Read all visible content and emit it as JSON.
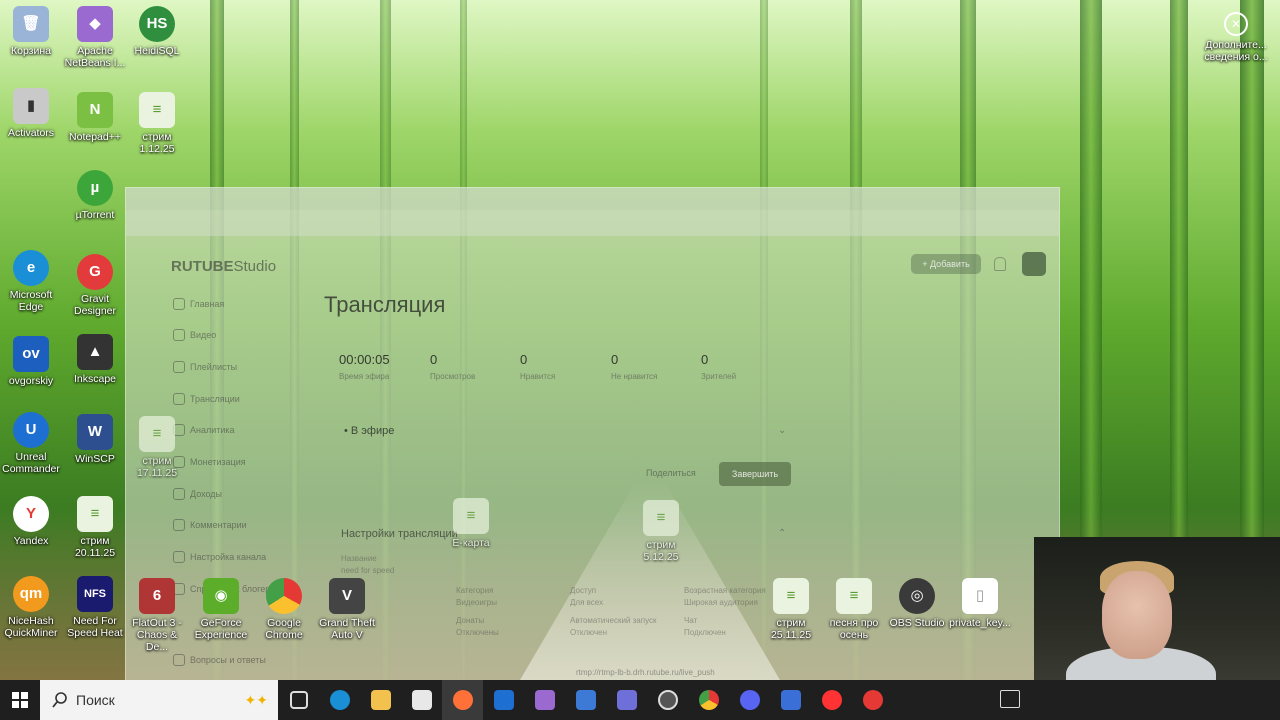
{
  "desktop": {
    "icons_left": [
      {
        "label": "Корзина",
        "color": "#9ab4d8",
        "glyph": "🗑"
      },
      {
        "label": "Activators",
        "color": "#c9c9c9",
        "glyph": "▮"
      },
      {
        "label": "µTorrent",
        "color": "#3da63a",
        "glyph": "µ"
      },
      {
        "label": "Microsoft Edge",
        "color": "#1a8fd6",
        "glyph": "e"
      },
      {
        "label": "ovgorskiy",
        "color": "#1d5fbf",
        "glyph": "ov"
      },
      {
        "label": "Unreal Commander",
        "color": "#1d6fd1",
        "glyph": "U"
      },
      {
        "label": "Yandex",
        "color": "#ffffff",
        "glyph": "Y"
      },
      {
        "label": "NiceHash QuickMiner",
        "color": "#f29a1d",
        "glyph": "qm"
      }
    ],
    "icons_col2": [
      {
        "label": "Apache NetBeans I...",
        "color": "#9b6ad1",
        "glyph": "◆"
      },
      {
        "label": "Notepad++",
        "color": "#7bc043",
        "glyph": "N"
      },
      {
        "label": "Gravit Designer",
        "color": "#e33b3b",
        "glyph": "G"
      },
      {
        "label": "Inkscape",
        "color": "#333333",
        "glyph": "▲"
      },
      {
        "label": "WinSCP",
        "color": "#2d4f8f",
        "glyph": "W"
      },
      {
        "label": "стрим 20.11.25",
        "color": "#eaf3df",
        "glyph": "≡"
      },
      {
        "label": "Need For Speed Heat",
        "color": "#1a1a6e",
        "glyph": "NFS"
      }
    ],
    "icons_col3": [
      {
        "label": "HeidiSQL",
        "color": "#2f8f3f",
        "glyph": "HS"
      },
      {
        "label": "стрим 1.12.25",
        "color": "#eaf3df",
        "glyph": "≡"
      }
    ],
    "icons_bottom": [
      {
        "label": "FlatOut 3 - Chaos & De...",
        "color": "#b03535",
        "glyph": "6"
      },
      {
        "label": "GeForce Experience",
        "color": "#5cae2a",
        "glyph": "◉"
      },
      {
        "label": "Google Chrome",
        "color": "#e9e9e9",
        "glyph": "◯"
      },
      {
        "label": "Grand Theft Auto V",
        "color": "#444444",
        "glyph": "V"
      },
      {
        "label": "стрим 25.11.25",
        "color": "#eaf3df",
        "glyph": "≡"
      },
      {
        "label": "песня про осень",
        "color": "#eaf3df",
        "glyph": "≡"
      },
      {
        "label": "OBS Studio",
        "color": "#3a3a3a",
        "glyph": "◎"
      },
      {
        "label": "private_key...",
        "color": "#ffffff",
        "glyph": "▯"
      }
    ],
    "icons_right": [
      {
        "label": "Дополните... сведения о...",
        "glyph": "✕"
      }
    ],
    "overlay_icons": [
      {
        "label": "стрим 17.11.25"
      },
      {
        "label": "Е-карта"
      },
      {
        "label": "стрим 5.12.25"
      }
    ]
  },
  "browser": {
    "logo": "RUTUBE",
    "logo_suffix": "Studio",
    "add_button": "+ Добавить",
    "sidebar": [
      "Главная",
      "Видео",
      "Плейлисты",
      "Трансляции",
      "Аналитика",
      "Монетизация",
      "Доходы",
      "Комментарии",
      "Настройка канала",
      "Справочник блогера",
      "Вопросы и ответы"
    ],
    "page_title": "Трансляция",
    "stats": [
      {
        "value": "00:00:05",
        "label": "Время эфира"
      },
      {
        "value": "0",
        "label": "Просмотров"
      },
      {
        "value": "0",
        "label": "Нравится"
      },
      {
        "value": "0",
        "label": "Не нравится"
      },
      {
        "value": "0",
        "label": "Зрителей"
      }
    ],
    "onair": "• В эфире",
    "share": "Поделиться",
    "finish": "Завершить",
    "settings_title": "Настройки трансляции",
    "settings_sub": "Название",
    "settings_name": "need for speed",
    "fields": [
      {
        "label": "Категория",
        "value": "Видеоигры"
      },
      {
        "label": "Доступ",
        "value": "Для всех"
      },
      {
        "label": "Возрастная категория",
        "value": "Широкая аудитория"
      },
      {
        "label": "Донаты",
        "value": "Отключены"
      },
      {
        "label": "Автоматический запуск",
        "value": "Отключен"
      },
      {
        "label": "Чат",
        "value": "Подключен"
      }
    ],
    "url_fragment": "rtmp://rtmp-lb-b.drh.rutube.ru/live_push"
  },
  "taskbar": {
    "search_placeholder": "Поиск",
    "apps": [
      {
        "name": "task-view",
        "color": "#cfcfcf"
      },
      {
        "name": "edge",
        "color": "#1a8fd6"
      },
      {
        "name": "explorer",
        "color": "#f2c14e"
      },
      {
        "name": "store",
        "color": "#e8e8e8"
      },
      {
        "name": "firefox",
        "color": "#ff7139"
      },
      {
        "name": "unreal-commander",
        "color": "#1d6fd1"
      },
      {
        "name": "netbeans",
        "color": "#9b6ad1"
      },
      {
        "name": "visual-studio",
        "color": "#3c7ad6"
      },
      {
        "name": "network-tool",
        "color": "#6f6fd9"
      },
      {
        "name": "obs",
        "color": "#555555"
      },
      {
        "name": "chrome",
        "color": "#e9e9e9"
      },
      {
        "name": "discord",
        "color": "#5865f2"
      },
      {
        "name": "vpn",
        "color": "#3b6fd8"
      },
      {
        "name": "yandex",
        "color": "#ff3333"
      },
      {
        "name": "yandex-browser",
        "color": "#e53935"
      }
    ]
  }
}
